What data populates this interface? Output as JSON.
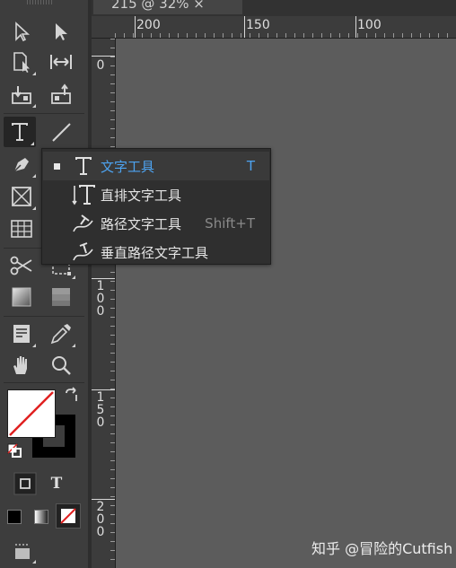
{
  "document_tab": {
    "label": "215 @ 32% ×"
  },
  "ruler_top": {
    "labels": [
      "200",
      "150",
      "100"
    ]
  },
  "ruler_left": {
    "labels": [
      "0",
      "1\n0\n0",
      "1\n5\n0",
      "2\n0\n0"
    ]
  },
  "flyout": {
    "items": [
      {
        "label": "文字工具",
        "shortcut": "T",
        "icon": "type-tool-icon",
        "selected": true
      },
      {
        "label": "直排文字工具",
        "shortcut": "",
        "icon": "vertical-type-tool-icon",
        "selected": false
      },
      {
        "label": "路径文字工具",
        "shortcut": "Shift+T",
        "icon": "type-on-path-tool-icon",
        "selected": false
      },
      {
        "label": "垂直路径文字工具",
        "shortcut": "",
        "icon": "vertical-type-on-path-tool-icon",
        "selected": false
      }
    ]
  },
  "toolbar": {
    "format_text_label": "T"
  },
  "colors": {
    "accent": "#4da3f0",
    "toolbar_bg": "#3d3d3d",
    "canvas_bg": "#5c5c5c",
    "none_slash": "#e02020"
  },
  "watermark": "知乎 @冒险的Cutfish"
}
